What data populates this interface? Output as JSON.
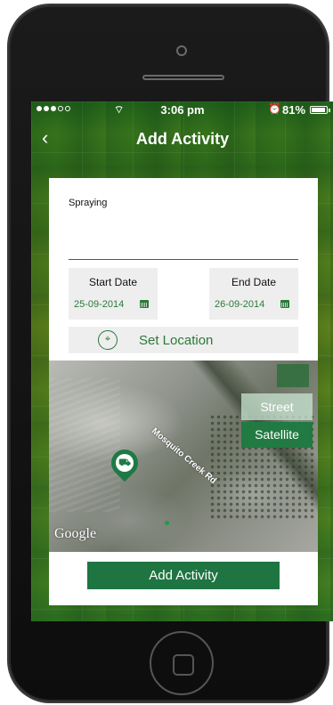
{
  "status_bar": {
    "time": "3:06 pm",
    "battery": "81%"
  },
  "nav": {
    "title": "Add Activity",
    "back_icon": "chevron-left-icon"
  },
  "form": {
    "activity": "Spraying",
    "start_date": {
      "label": "Start Date",
      "value": "25-09-2014"
    },
    "end_date": {
      "label": "End Date",
      "value": "26-09-2014"
    },
    "set_location_label": "Set Location"
  },
  "map": {
    "road_label": "Mosquito Creek Rd",
    "street_label": "Street",
    "satellite_label": "Satellite",
    "selected_map_type": "Satellite",
    "google_label": "Google"
  },
  "actions": {
    "add_activity_label": "Add Activity"
  },
  "colors": {
    "accent": "#1f7542",
    "field_text": "#2a7a3a"
  }
}
